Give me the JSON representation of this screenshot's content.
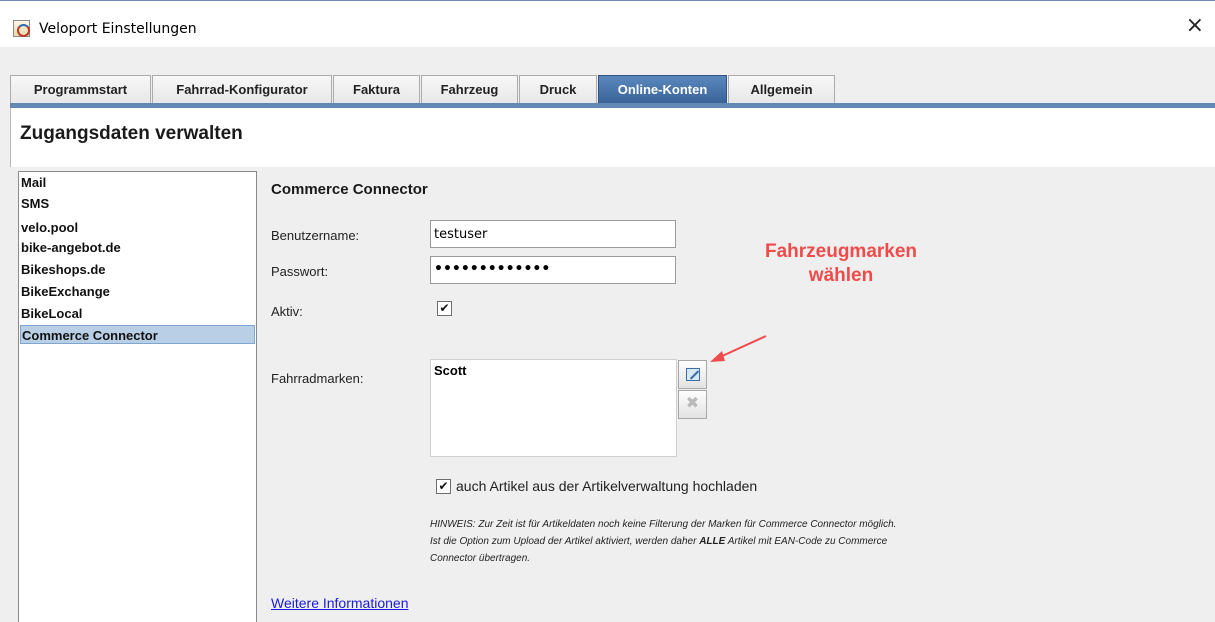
{
  "window": {
    "title": "Veloport Einstellungen",
    "close_glyph": "×"
  },
  "tabs": [
    {
      "label": "Programmstart",
      "active": false
    },
    {
      "label": "Fahrrad-Konfigurator",
      "active": false
    },
    {
      "label": "Faktura",
      "active": false
    },
    {
      "label": "Fahrzeug",
      "active": false
    },
    {
      "label": "Druck",
      "active": false
    },
    {
      "label": "Online-Konten",
      "active": true
    },
    {
      "label": "Allgemein",
      "active": false
    }
  ],
  "page": {
    "title": "Zugangsdaten verwalten"
  },
  "accounts": {
    "items": [
      {
        "label": "Mail",
        "selected": false
      },
      {
        "label": "SMS",
        "selected": false
      },
      {
        "label": "velo.pool",
        "selected": false
      },
      {
        "label": "bike-angebot.de",
        "selected": false
      },
      {
        "label": "Bikeshops.de",
        "selected": false
      },
      {
        "label": "BikeExchange",
        "selected": false
      },
      {
        "label": "BikeLocal",
        "selected": false
      },
      {
        "label": "Commerce Connector",
        "selected": true
      }
    ]
  },
  "form": {
    "section_title": "Commerce Connector",
    "username_label": "Benutzername:",
    "username_value": "testuser",
    "password_label": "Passwort:",
    "password_value": "•••••••••••••",
    "active_label": "Aktiv:",
    "active_checked": true,
    "brands_label": "Fahrradmarken:",
    "brands": [
      "Scott"
    ],
    "edit_brands_icon": "edit-icon",
    "delete_brand_icon": "delete-icon",
    "delete_glyph": "✖",
    "upload_checked": true,
    "upload_label": "auch Artikel aus der Artikelverwaltung hochladen",
    "note_line1": "HINWEIS: Zur Zeit ist für Artikeldaten noch keine Filterung der Marken für Commerce Connector möglich.",
    "note_line2_pre": "Ist die Option zum Upload der Artikel aktiviert, werden daher ",
    "note_line2_bold": "ALLE",
    "note_line2_post": " Artikel mit EAN-Code zu Commerce",
    "note_line3": "Connector übertragen.",
    "more_info_link": "Weitere Informationen"
  },
  "annotation": {
    "line1": "Fahrzeugmarken",
    "line2": "wählen",
    "color": "#f04b4b"
  }
}
